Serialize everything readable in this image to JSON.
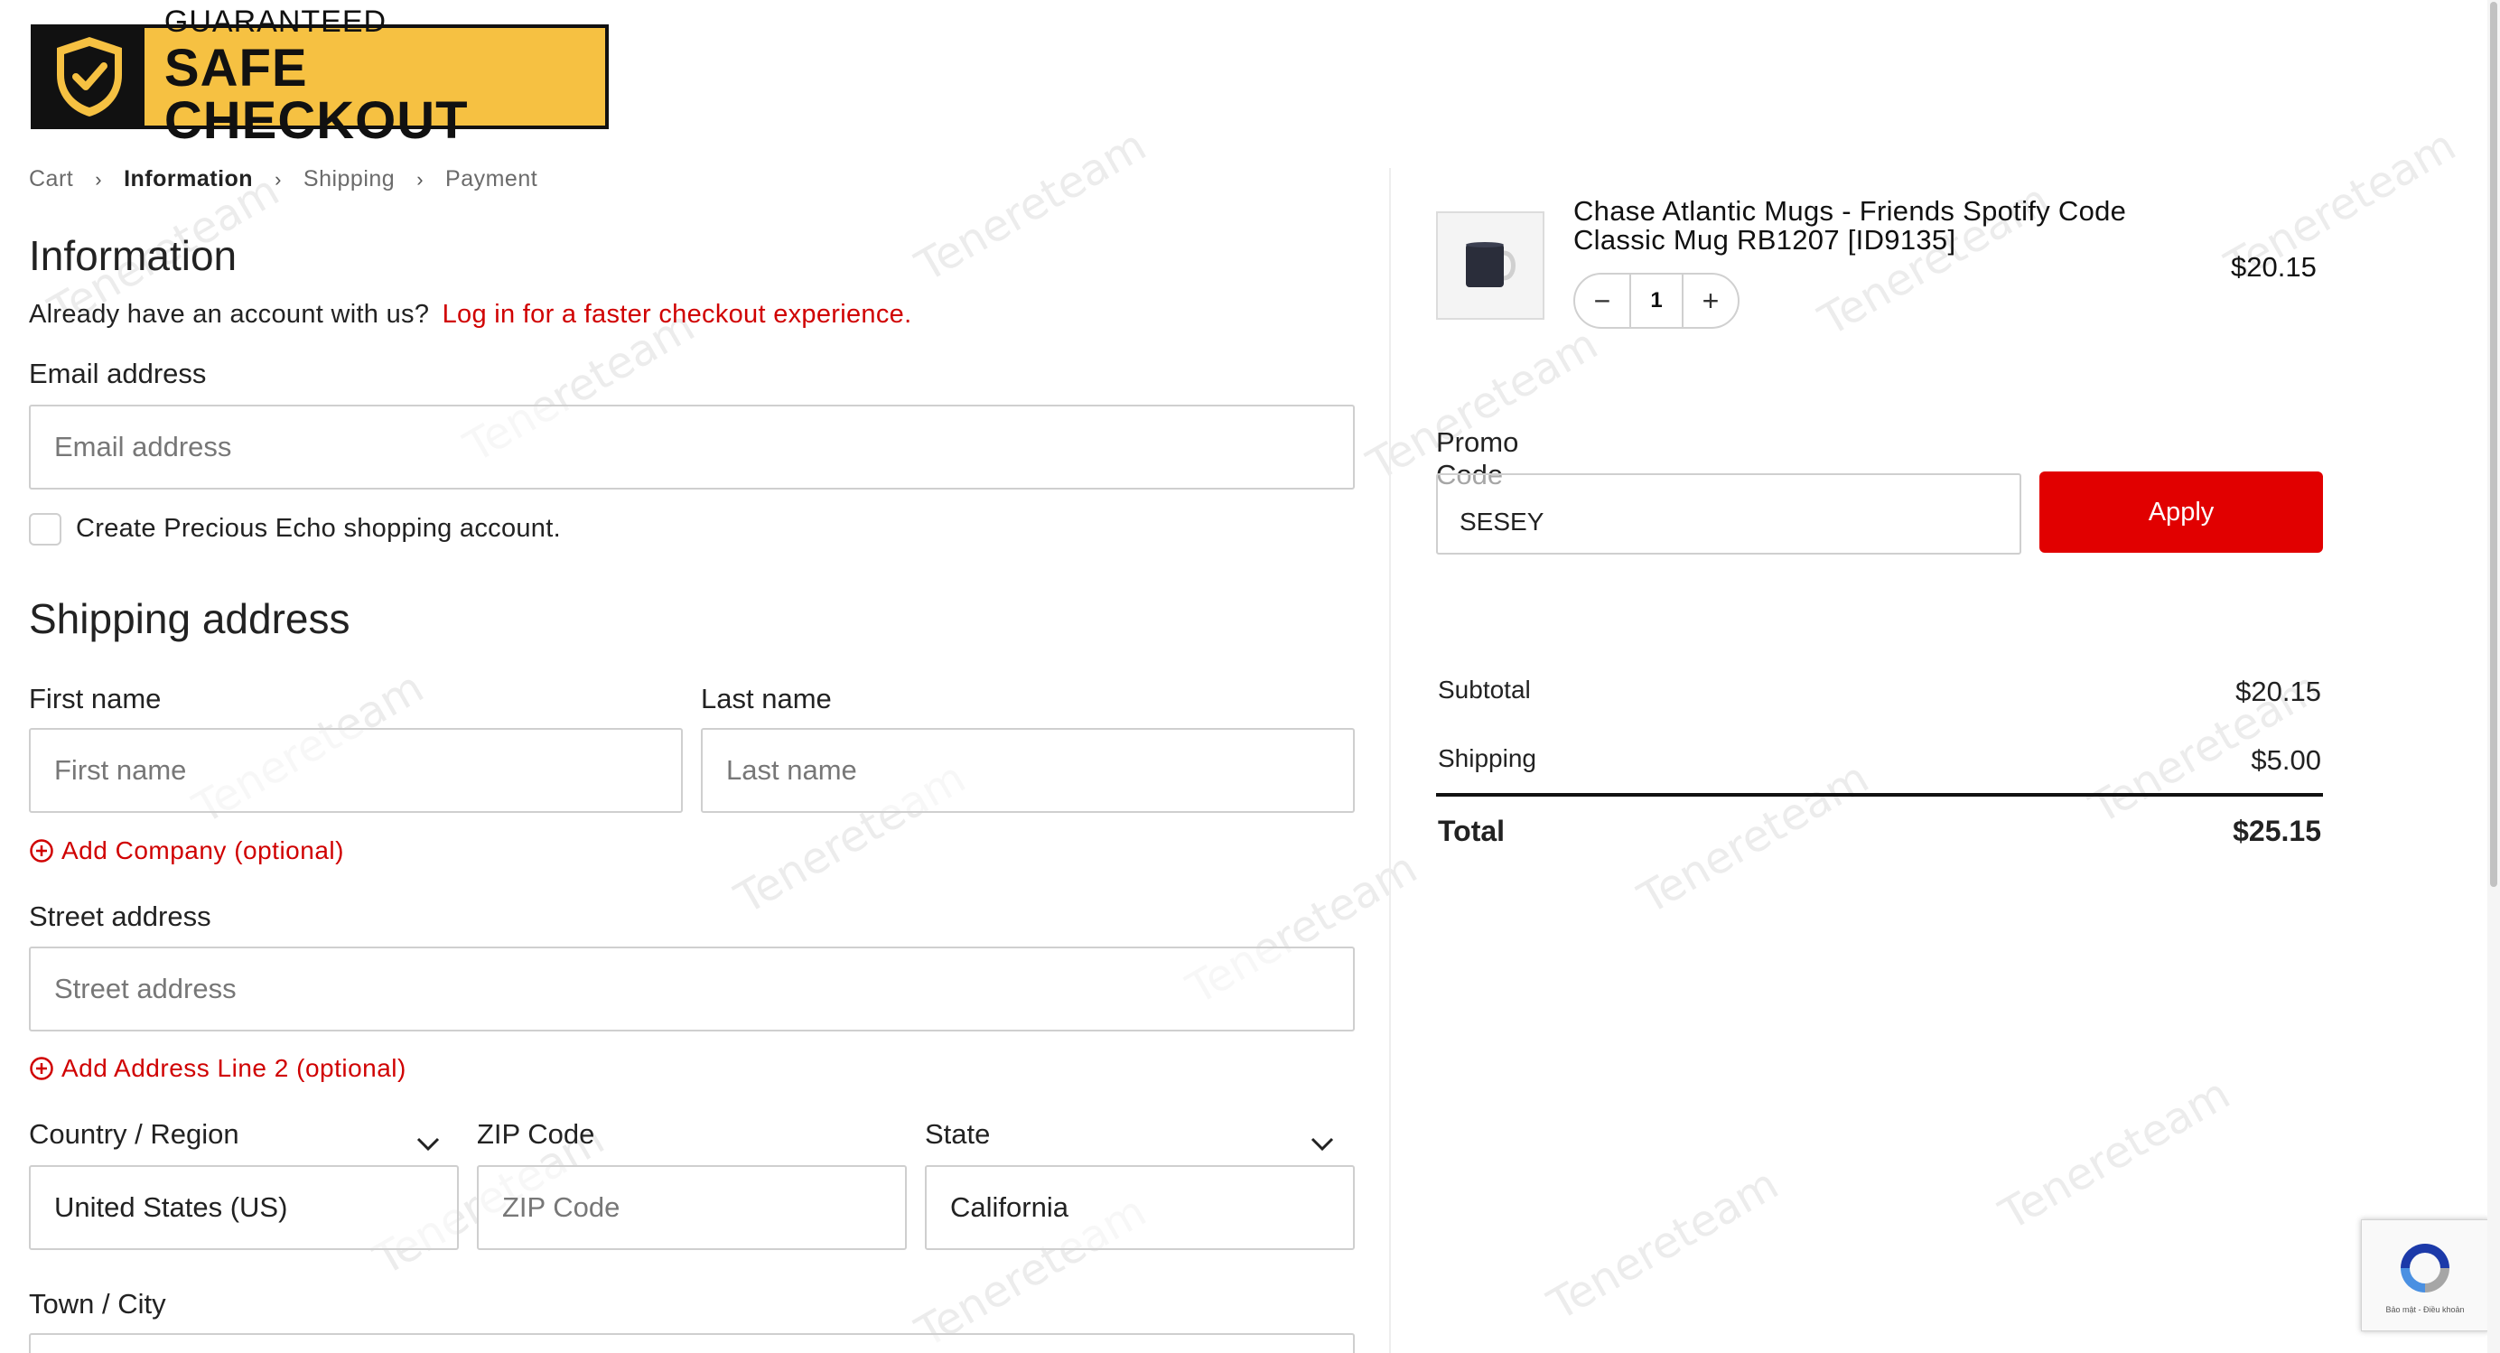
{
  "badge": {
    "line1": "GUARANTEED",
    "line2": "SAFE CHECKOUT"
  },
  "breadcrumb": [
    {
      "label": "Cart",
      "active": false
    },
    {
      "label": "Information",
      "active": true
    },
    {
      "label": "Shipping",
      "active": false
    },
    {
      "label": "Payment",
      "active": false
    }
  ],
  "information": {
    "heading": "Information",
    "account_prompt": "Already have an account with us?",
    "login_link": "Log in for a faster checkout experience.",
    "email_label": "Email address",
    "email_placeholder": "Email address",
    "create_account_label": "Create Precious Echo shopping account."
  },
  "shipping": {
    "heading": "Shipping address",
    "first_name_label": "First name",
    "first_name_placeholder": "First name",
    "last_name_label": "Last name",
    "last_name_placeholder": "Last name",
    "add_company": "Add Company (optional)",
    "street_label": "Street address",
    "street_placeholder": "Street address",
    "add_address2": "Add Address Line 2 (optional)",
    "country_label": "Country / Region",
    "country_value": "United States (US)",
    "zip_label": "ZIP Code",
    "zip_placeholder": "ZIP Code",
    "state_label": "State",
    "state_value": "California",
    "city_label": "Town / City"
  },
  "cart": {
    "product_title": "Chase Atlantic Mugs - Friends Spotify Code Classic Mug RB1207 [ID9135]",
    "price": "$20.15",
    "quantity": "1",
    "minus": "−",
    "plus": "+"
  },
  "promo": {
    "label": "Promo Code",
    "value": "SESEY",
    "apply_label": "Apply"
  },
  "summary": {
    "subtotal_label": "Subtotal",
    "subtotal_value": "$20.15",
    "shipping_label": "Shipping",
    "shipping_value": "$5.00",
    "total_label": "Total",
    "total_value": "$25.15"
  },
  "recaptcha": {
    "terms": "Bảo mật - Điều khoản"
  },
  "colors": {
    "accent": "#e10000",
    "badge_bg": "#f6c142",
    "link": "#d00000"
  },
  "watermark": "Tenereteam"
}
